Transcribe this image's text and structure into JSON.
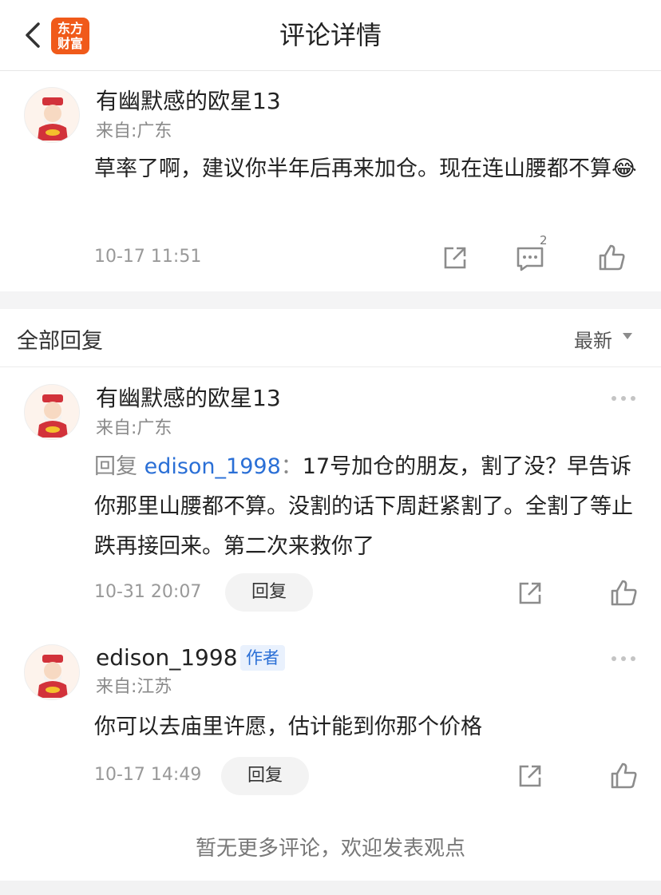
{
  "header": {
    "title": "评论详情",
    "logo_line1": "东方",
    "logo_line2": "财富",
    "back_icon": "chevron-left-icon",
    "brand_color": "#f05a1a"
  },
  "main_comment": {
    "username": "有幽默感的欧星13",
    "location": "来自:广东",
    "text": "草率了啊，建议你半年后再来加仓。现在连山腰都不算😂",
    "time": "10-17 11:51",
    "reply_count": "2",
    "icons": [
      "share-icon",
      "comment-icon",
      "like-icon"
    ]
  },
  "section": {
    "title": "全部回复",
    "sort_label": "最新"
  },
  "replies": [
    {
      "username": "有幽默感的欧星13",
      "location": "来自:广东",
      "reply_prefix": "回复",
      "reply_to": "edison_1998",
      "separator": "：",
      "text": "17号加仓的朋友，割了没？早告诉你那里山腰都不算。没割的话下周赶紧割了。全割了等止跌再接回来。第二次来救你了",
      "time": "10-31 20:07",
      "reply_button": "回复"
    },
    {
      "username": "edison_1998",
      "author_badge": "作者",
      "location": "来自:江苏",
      "text": "你可以去庙里许愿，估计能到你那个价格",
      "time": "10-17 14:49",
      "reply_button": "回复"
    }
  ],
  "footer": {
    "text": "暂无更多评论，欢迎发表观点"
  },
  "colors": {
    "link": "#2a6fd6",
    "muted": "#999999",
    "divider": "#f4f4f5"
  }
}
